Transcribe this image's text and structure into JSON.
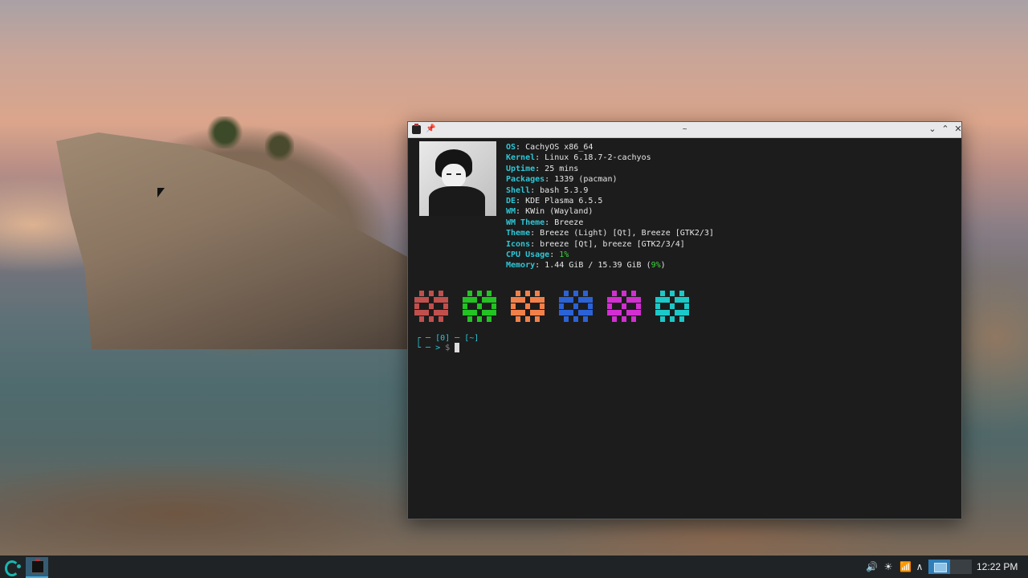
{
  "window": {
    "title": "~",
    "pin_glyph": "📌",
    "minimize_glyph": "⌄",
    "maximize_glyph": "⌃",
    "close_glyph": "✕"
  },
  "fastfetch": [
    {
      "key": "OS",
      "value": "CachyOS x86_64"
    },
    {
      "key": "Kernel",
      "value": "Linux 6.18.7-2-cachyos"
    },
    {
      "key": "Uptime",
      "value": "25 mins"
    },
    {
      "key": "Packages",
      "value": "1339 (pacman)"
    },
    {
      "key": "Shell",
      "value": "bash 5.3.9"
    },
    {
      "key": "DE",
      "value": "KDE Plasma 6.5.5"
    },
    {
      "key": "WM",
      "value": "KWin (Wayland)"
    },
    {
      "key": "WM Theme",
      "value": "Breeze"
    },
    {
      "key": "Theme",
      "value": "Breeze (Light) [Qt], Breeze [GTK2/3]"
    },
    {
      "key": "Icons",
      "value": "breeze [Qt], breeze [GTK2/3/4]"
    },
    {
      "key": "CPU Usage",
      "value": "1%"
    },
    {
      "key": "Memory",
      "value": "1.44 GiB / 15.39 GiB (9%)",
      "value_main": "1.44 GiB / 15.39 GiB (",
      "value_pct": "9%",
      "value_end": ")"
    }
  ],
  "palette_colors": [
    "#c0504d",
    "#22c322",
    "#f2804a",
    "#2b62d6",
    "#d22fd2",
    "#1cc8c8"
  ],
  "prompt": {
    "line1_open": "┌ ─ ",
    "exit_code": "[0]",
    "dash": " ─ ",
    "dir": "[~]",
    "line2_open": "└ ─ > ",
    "symbol": "$ "
  },
  "taskbar": {
    "clock": "12:22 PM",
    "volume_glyph": "🔊",
    "brightness_glyph": "☀",
    "network_glyph": "📶",
    "expand_glyph": "∧"
  },
  "colors": {
    "accent": "#3daee9",
    "key_color": "#2ec6d6",
    "good_color": "#3fd43f"
  }
}
